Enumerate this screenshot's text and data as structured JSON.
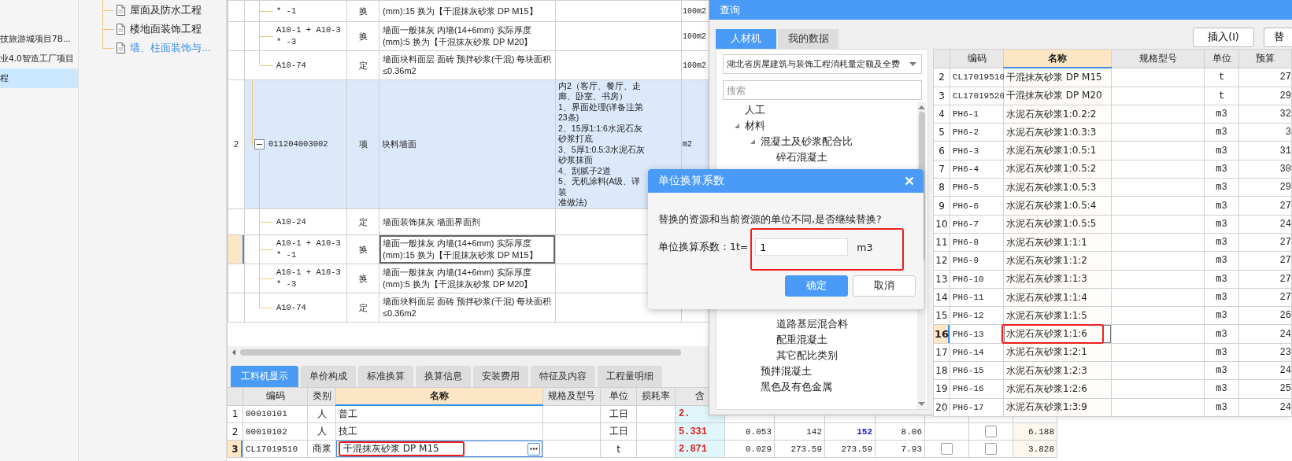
{
  "sidebar": {
    "items": [
      {
        "label": "技旅游城项目7B...",
        "selected": false
      },
      {
        "label": "业4.0智造工厂项目",
        "selected": false
      },
      {
        "label": "程",
        "selected": true
      }
    ]
  },
  "project_tree": {
    "items": [
      {
        "label": "屋面及防水工程",
        "selected": false
      },
      {
        "label": "楼地面装饰工程",
        "selected": false
      },
      {
        "label": "墙、柱面装饰与...",
        "selected": true
      }
    ]
  },
  "bill_table": {
    "groups": [
      {
        "children": [
          {
            "code": "* -1",
            "type": "换",
            "name": "(mm):15  换为【干混抹灰砂浆 DP M15】",
            "unit": "100m2",
            "selected": false
          },
          {
            "code": "A10-1 + A10-3 * -3",
            "type": "换",
            "name": "墙面一般抹灰 内墙(14+6mm)  实际厚度(mm):5  换为【干混抹灰砂浆 DP M20】",
            "unit": "100m2",
            "selected": false
          },
          {
            "code": "A10-74",
            "type": "定",
            "name": "墙面块料面层 面砖 预拌砂浆(干混) 每块面积≤0.36m2",
            "unit": "100m2",
            "selected": false
          }
        ]
      },
      {
        "number": "2",
        "code": "011204003002",
        "type": "项",
        "name": "块料墙面",
        "feature_lines": [
          "内2（客厅、餐厅、走廊、卧室、书房）",
          "1、界面处理(详备注第23条)",
          "2、15厚1:1:6水泥石灰砂浆打底",
          "3、5厚1:0.5:3水泥石灰砂浆抹面",
          "4、刮腻子2道",
          "5、无机涂料(A级、详装",
          "准做法)"
        ],
        "unit": "m2",
        "expanded": true,
        "selected": true,
        "children": [
          {
            "code": "A10-24",
            "type": "定",
            "name": "墙面装饰抹灰 墙面界面剂",
            "selected": false
          },
          {
            "code": "A10-1 + A10-3 * -1",
            "type": "换",
            "name": "墙面一般抹灰 内墙(14+6mm)  实际厚度(mm):15  换为【干混抹灰砂浆 DP M15】",
            "selected": true
          },
          {
            "code": "A10-1 + A10-3 * -3",
            "type": "换",
            "name": "墙面一般抹灰 内墙(14+6mm)  实际厚度(mm):5  换为【干混抹灰砂浆 DP M20】",
            "selected": false
          },
          {
            "code": "A10-74",
            "type": "定",
            "name": "墙面块料面层 面砖 预拌砂浆(干混) 每块面积≤0.36m2",
            "selected": false
          }
        ]
      }
    ]
  },
  "bottom_tabs": [
    {
      "label": "工料机显示",
      "selected": true
    },
    {
      "label": "单价构成",
      "selected": false
    },
    {
      "label": "标准换算",
      "selected": false
    },
    {
      "label": "换算信息",
      "selected": false
    },
    {
      "label": "安装费用",
      "selected": false
    },
    {
      "label": "特征及内容",
      "selected": false
    },
    {
      "label": "工程量明细",
      "selected": false
    }
  ],
  "bottom_table": {
    "columns": [
      {
        "label": "编码",
        "selected": false
      },
      {
        "label": "类别",
        "selected": false
      },
      {
        "label": "名称",
        "selected": true
      },
      {
        "label": "规格及型号",
        "selected": false
      },
      {
        "label": "单位",
        "selected": false
      },
      {
        "label": "损耗率",
        "selected": false
      },
      {
        "label": "含",
        "selected": false
      }
    ],
    "rows": [
      {
        "number": "1",
        "code": "00010101",
        "type": "人",
        "name": "普工",
        "unit": "工日",
        "quantity": "2.",
        "selected": false,
        "highlighted": false,
        "cells": []
      },
      {
        "number": "2",
        "code": "00010102",
        "type": "人",
        "name": "技工",
        "unit": "工日",
        "quantity": "5.331",
        "selected": false,
        "highlighted": false,
        "cells": [
          {
            "kind": "number",
            "text": "0.053"
          },
          {
            "kind": "number",
            "text": "142"
          },
          {
            "kind": "changed",
            "text": "152"
          },
          {
            "kind": "number",
            "text": "8.06"
          },
          {
            "kind": "blank"
          },
          {
            "kind": "checkbox",
            "checked": false
          },
          {
            "kind": "total",
            "text": "6.188"
          }
        ]
      },
      {
        "number": "3",
        "code": "CL17019510",
        "type": "商浆",
        "name": "干混抹灰砂浆 DP M15",
        "unit": "t",
        "quantity": "2.871",
        "selected": true,
        "highlighted": true,
        "cells": [
          {
            "kind": "number",
            "text": "0.029"
          },
          {
            "kind": "number",
            "text": "273.59"
          },
          {
            "kind": "number",
            "text": "273.59"
          },
          {
            "kind": "number",
            "text": "7.93"
          },
          {
            "kind": "checkbox",
            "checked": false
          },
          {
            "kind": "checkbox",
            "checked": false
          },
          {
            "kind": "total",
            "text": "3.828"
          }
        ]
      }
    ]
  },
  "query_window": {
    "title": "查询",
    "tabs": [
      {
        "label": "人材机",
        "selected": true
      },
      {
        "label": "我的数据",
        "selected": false
      }
    ],
    "buttons": [
      "插入(I)",
      "替"
    ],
    "library": "湖北省房屋建筑与装饰工程消耗量定额及全费",
    "search": {
      "placeholder": "搜索"
    },
    "tree": [
      {
        "label": "人工"
      },
      {
        "label": "材料",
        "expanded": true,
        "children": [
          {
            "label": "混凝土及砂浆配合比",
            "expanded": true,
            "children": [
              {
                "label": "碎石混凝土"
              },
              {
                "label": "道路基层混合料"
              },
              {
                "label": "配重混凝土"
              },
              {
                "label": "其它配比类别"
              }
            ]
          },
          {
            "label": "预拌混凝土"
          },
          {
            "label": "黑色及有色金属"
          }
        ]
      }
    ],
    "columns": [
      {
        "label": "编码",
        "selected": false
      },
      {
        "label": "名称",
        "selected": true
      },
      {
        "label": "规格型号",
        "selected": false
      },
      {
        "label": "单位",
        "selected": false
      },
      {
        "label": "预算",
        "selected": false
      }
    ],
    "rows": [
      {
        "number": "2",
        "code": "CL17019510",
        "name": "干混抹灰砂浆 DP M15",
        "unit": "t",
        "price": "27",
        "selected": false,
        "highlighted": false
      },
      {
        "number": "3",
        "code": "CL17019520",
        "name": "干混抹灰砂浆 DP M20",
        "unit": "t",
        "price": "29",
        "selected": false,
        "highlighted": false
      },
      {
        "number": "4",
        "code": "PH6-1",
        "name": "水泥石灰砂浆1:0.2:2",
        "unit": "m3",
        "price": "32",
        "selected": false,
        "highlighted": false
      },
      {
        "number": "5",
        "code": "PH6-2",
        "name": "水泥石灰砂浆1:0.3:3",
        "unit": "m3",
        "price": "3",
        "selected": false,
        "highlighted": false
      },
      {
        "number": "6",
        "code": "PH6-3",
        "name": "水泥石灰砂浆1:0.5:1",
        "unit": "m3",
        "price": "31",
        "selected": false,
        "highlighted": false
      },
      {
        "number": "7",
        "code": "PH6-4",
        "name": "水泥石灰砂浆1:0.5:2",
        "unit": "m3",
        "price": "30",
        "selected": false,
        "highlighted": false
      },
      {
        "number": "8",
        "code": "PH6-5",
        "name": "水泥石灰砂浆1:0.5:3",
        "unit": "m3",
        "price": "29",
        "selected": false,
        "highlighted": false
      },
      {
        "number": "9",
        "code": "PH6-6",
        "name": "水泥石灰砂浆1:0.5:4",
        "unit": "m3",
        "price": "27",
        "selected": false,
        "highlighted": false
      },
      {
        "number": "10",
        "code": "PH6-7",
        "name": "水泥石灰砂浆1:0.5:5",
        "unit": "m3",
        "price": "24",
        "selected": false,
        "highlighted": false
      },
      {
        "number": "11",
        "code": "PH6-8",
        "name": "水泥石灰砂浆1:1:1",
        "unit": "m3",
        "price": "27",
        "selected": false,
        "highlighted": false
      },
      {
        "number": "12",
        "code": "PH6-9",
        "name": "水泥石灰砂浆1:1:2",
        "unit": "m3",
        "price": "27",
        "selected": false,
        "highlighted": false
      },
      {
        "number": "13",
        "code": "PH6-10",
        "name": "水泥石灰砂浆1:1:3",
        "unit": "m3",
        "price": "27",
        "selected": false,
        "highlighted": false
      },
      {
        "number": "14",
        "code": "PH6-11",
        "name": "水泥石灰砂浆1:1:4",
        "unit": "m3",
        "price": "27",
        "selected": false,
        "highlighted": false
      },
      {
        "number": "15",
        "code": "PH6-12",
        "name": "水泥石灰砂浆1:1:5",
        "unit": "m3",
        "price": "26",
        "selected": false,
        "highlighted": false
      },
      {
        "number": "16",
        "code": "PH6-13",
        "name": "水泥石灰砂浆1:1:6",
        "unit": "m3",
        "price": "24",
        "selected": true,
        "highlighted": true
      },
      {
        "number": "17",
        "code": "PH6-14",
        "name": "水泥石灰砂浆1:2:1",
        "unit": "m3",
        "price": "23",
        "selected": false,
        "highlighted": false
      },
      {
        "number": "18",
        "code": "PH6-15",
        "name": "水泥石灰砂浆1:2:3",
        "unit": "m3",
        "price": "24",
        "selected": false,
        "highlighted": false
      },
      {
        "number": "19",
        "code": "PH6-16",
        "name": "水泥石灰砂浆1:2:6",
        "unit": "m3",
        "price": "25",
        "selected": false,
        "highlighted": false
      },
      {
        "number": "20",
        "code": "PH6-17",
        "name": "水泥石灰砂浆1:3:9",
        "unit": "m3",
        "price": "24",
        "selected": false,
        "highlighted": false
      }
    ]
  },
  "dialog": {
    "title": "单位换算系数",
    "message": "替换的资源和当前资源的单位不同,是否继续替换?",
    "label": "单位换算系数：1t=",
    "value": "1",
    "unit": "m3",
    "highlighted": true,
    "buttons": [
      {
        "label": "确定",
        "kind": "primary"
      },
      {
        "label": "取消",
        "kind": "secondary"
      }
    ]
  }
}
